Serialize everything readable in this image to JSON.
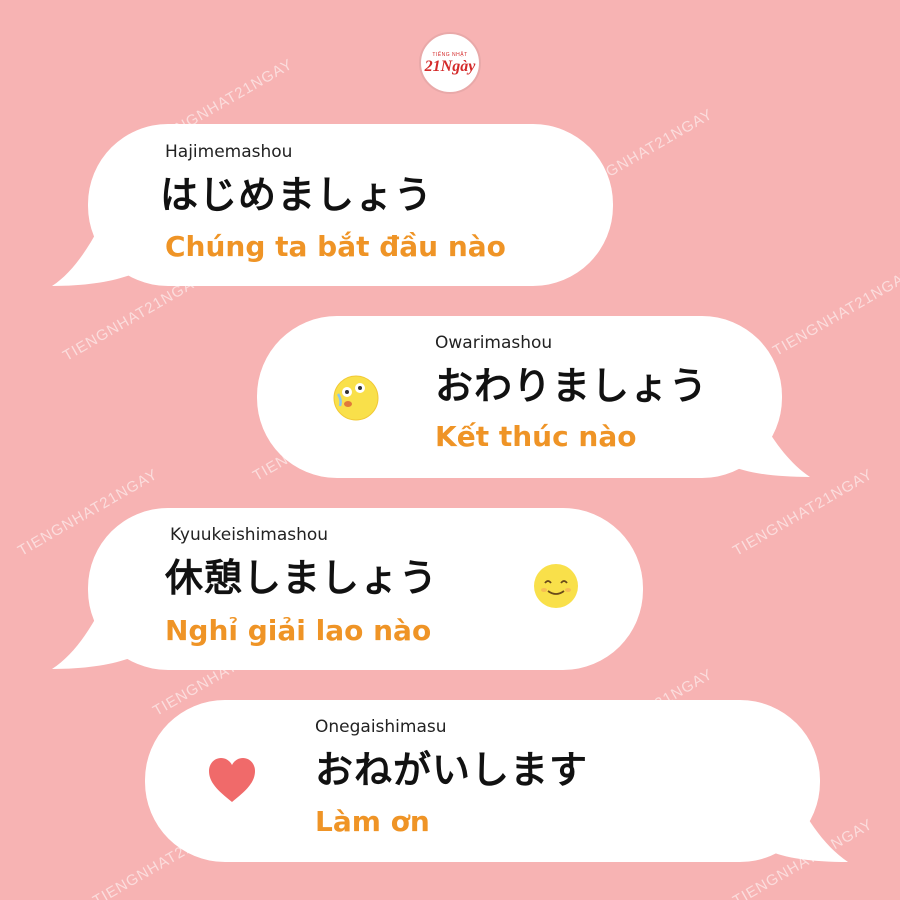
{
  "logo": {
    "small_text": "TIẾNG NHẬT",
    "main_text": "21Ngày"
  },
  "watermark_text": "TIENGNHAT21NGAY",
  "phrases": [
    {
      "romaji": "Hajimemashou",
      "japanese": "はじめましょう",
      "vietnamese": "Chúng ta bắt đầu nào"
    },
    {
      "romaji": "Owarimashou",
      "japanese": "おわりましょう",
      "vietnamese": "Kết thúc nào"
    },
    {
      "romaji": "Kyuukeishimashou",
      "japanese": "休憩しましょう",
      "vietnamese": "Nghỉ giải lao nào"
    },
    {
      "romaji": "Onegaishimasu",
      "japanese": "おねがいします",
      "vietnamese": "Làm ơn"
    }
  ],
  "icons": [
    "surprised-emoji-icon",
    "smiling-emoji-icon",
    "heart-icon"
  ],
  "colors": {
    "background": "#f7b3b3",
    "bubble": "#ffffff",
    "translation": "#ef9426",
    "heart": "#f06a6a",
    "emoji": "#f9e04a"
  }
}
